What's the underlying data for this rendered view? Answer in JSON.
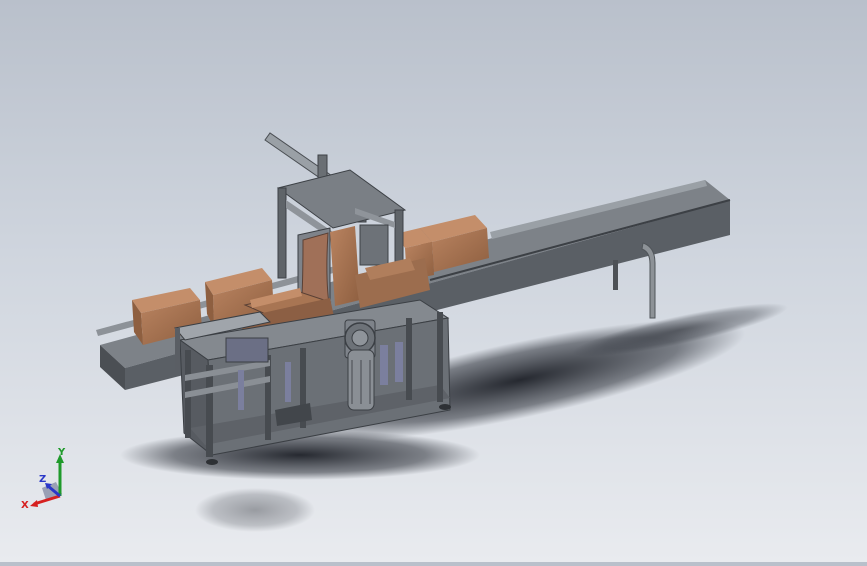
{
  "viewport": {
    "background_top": "#b9c0cb",
    "background_bottom": "#e9ebef",
    "model_color": "#6f7479",
    "box_color": "#a87553",
    "highlight_color": "#7b7f9e"
  },
  "triad": {
    "x_label": "X",
    "y_label": "Y",
    "z_label": "Z",
    "x_color": "#d62020",
    "y_color": "#1f9a2b",
    "z_color": "#2a37c8"
  }
}
